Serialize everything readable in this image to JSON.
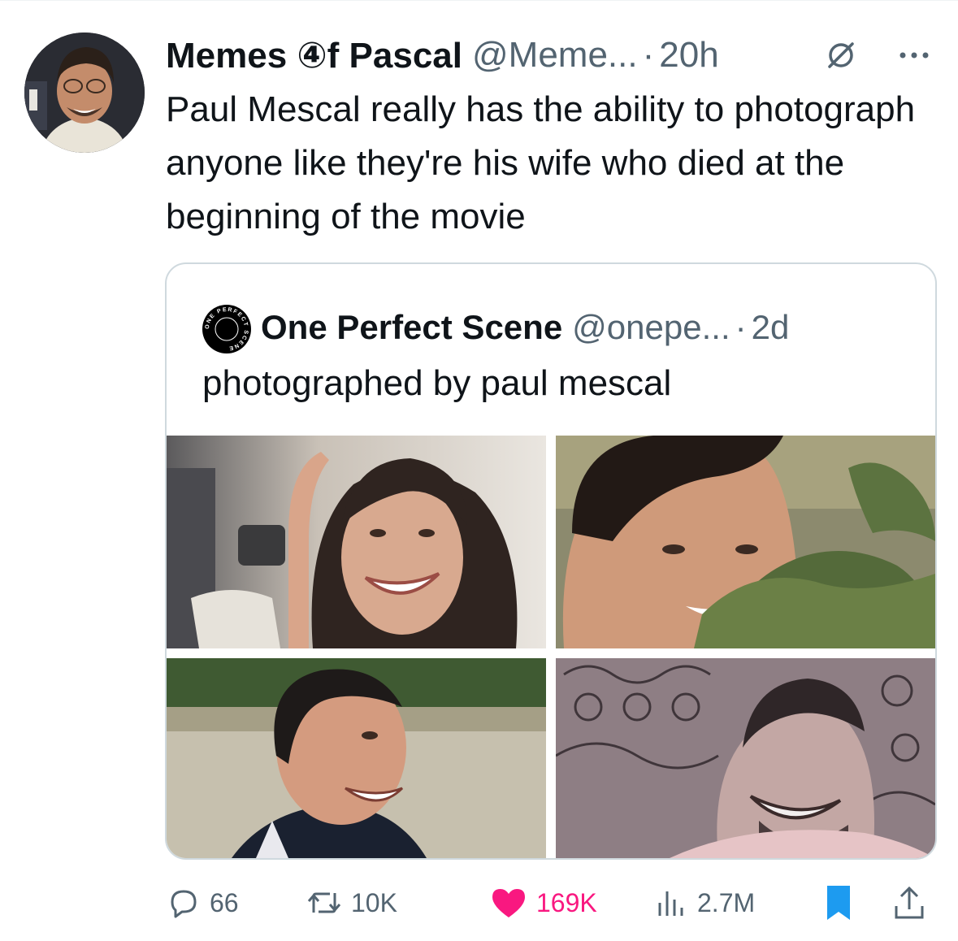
{
  "author": {
    "display_name": "Memes ④f Pascal",
    "handle": "@Meme...",
    "separator": "·",
    "time": "20h",
    "avatar_icon": "profile-photo-avatar",
    "grok_icon": "grok-icon",
    "more_icon": "more-icon"
  },
  "tweet": {
    "text": "Paul Mescal really has the ability to photograph anyone like they're his wife who died at the beginning of the movie"
  },
  "quoted": {
    "display_name": "One Perfect Scene",
    "handle": "@onepe...",
    "separator": "·",
    "time": "2d",
    "avatar_icon": "one-perfect-scene-logo",
    "avatar_text": "ONE PERFECT SCENE",
    "text": "photographed by paul mescal",
    "photos": [
      "photo-woman-smiling",
      "photo-man-behind-plant",
      "photo-man-outdoors",
      "photo-man-laughing"
    ]
  },
  "actions": {
    "replies": "66",
    "reposts": "10K",
    "likes": "169K",
    "views": "2.7M",
    "icons": [
      "reply-icon",
      "repost-icon",
      "like-icon",
      "views-icon",
      "bookmark-icon",
      "share-icon"
    ]
  },
  "colors": {
    "text": "#0f1419",
    "secondary": "#536471",
    "like": "#f91880",
    "bookmark": "#1d9bf0",
    "border": "#cfd9de"
  }
}
